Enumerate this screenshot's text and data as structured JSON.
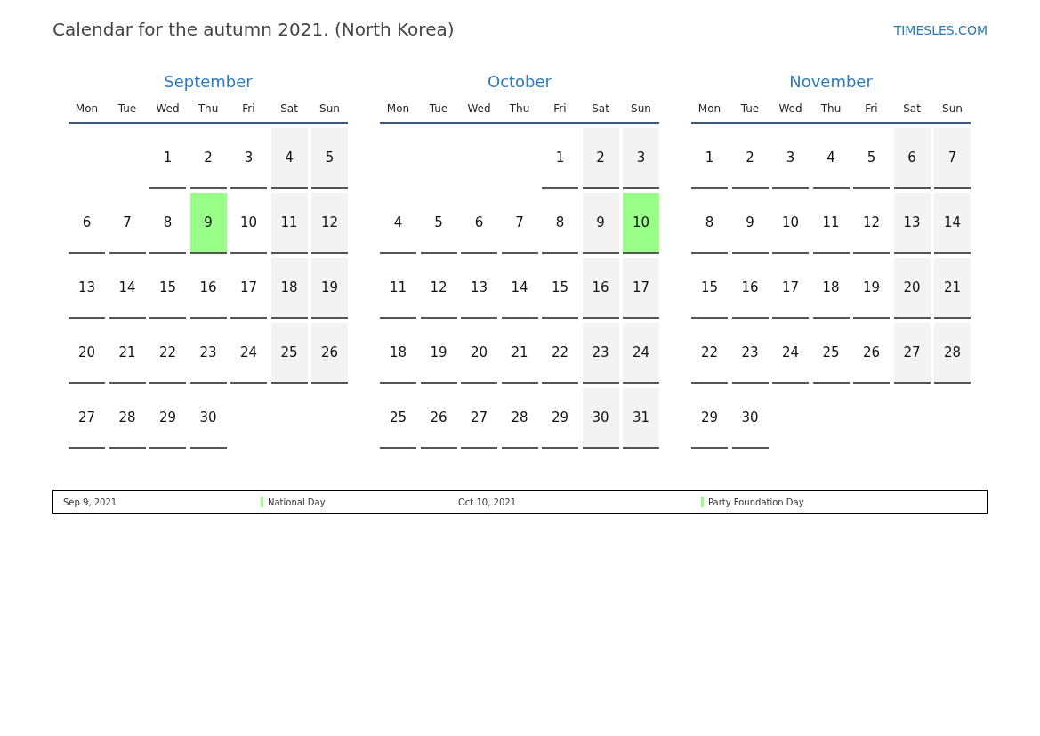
{
  "title": "Calendar for the autumn 2021. (North Korea)",
  "site_link": "TIMESLES.COM",
  "months": [
    {
      "name": "September",
      "weekdays": [
        "Mon",
        "Tue",
        "Wed",
        "Thu",
        "Fri",
        "Sat",
        "Sun"
      ],
      "weeks": [
        [
          {
            "d": "1",
            "kind": "weekday"
          },
          {
            "d": "2",
            "kind": "weekday"
          },
          {
            "d": "3",
            "kind": "weekday"
          },
          {
            "d": "4",
            "kind": "weekend"
          },
          {
            "d": "5",
            "kind": "weekend"
          }
        ],
        [
          {
            "d": "6",
            "kind": "weekday"
          },
          {
            "d": "7",
            "kind": "weekday"
          },
          {
            "d": "8",
            "kind": "weekday"
          },
          {
            "d": "9",
            "kind": "holiday"
          },
          {
            "d": "10",
            "kind": "weekday"
          },
          {
            "d": "11",
            "kind": "weekend"
          },
          {
            "d": "12",
            "kind": "weekend"
          }
        ],
        [
          {
            "d": "13",
            "kind": "weekday"
          },
          {
            "d": "14",
            "kind": "weekday"
          },
          {
            "d": "15",
            "kind": "weekday"
          },
          {
            "d": "16",
            "kind": "weekday"
          },
          {
            "d": "17",
            "kind": "weekday"
          },
          {
            "d": "18",
            "kind": "weekend"
          },
          {
            "d": "19",
            "kind": "weekend"
          }
        ],
        [
          {
            "d": "20",
            "kind": "weekday"
          },
          {
            "d": "21",
            "kind": "weekday"
          },
          {
            "d": "22",
            "kind": "weekday"
          },
          {
            "d": "23",
            "kind": "weekday"
          },
          {
            "d": "24",
            "kind": "weekday"
          },
          {
            "d": "25",
            "kind": "weekend"
          },
          {
            "d": "26",
            "kind": "weekend"
          }
        ],
        [
          {
            "d": "27",
            "kind": "weekday"
          },
          {
            "d": "28",
            "kind": "weekday"
          },
          {
            "d": "29",
            "kind": "weekday"
          },
          {
            "d": "30",
            "kind": "weekday"
          }
        ]
      ]
    },
    {
      "name": "October",
      "weekdays": [
        "Mon",
        "Tue",
        "Wed",
        "Thu",
        "Fri",
        "Sat",
        "Sun"
      ],
      "weeks": [
        [
          {
            "d": "1",
            "kind": "weekday"
          },
          {
            "d": "2",
            "kind": "weekend"
          },
          {
            "d": "3",
            "kind": "weekend"
          }
        ],
        [
          {
            "d": "4",
            "kind": "weekday"
          },
          {
            "d": "5",
            "kind": "weekday"
          },
          {
            "d": "6",
            "kind": "weekday"
          },
          {
            "d": "7",
            "kind": "weekday"
          },
          {
            "d": "8",
            "kind": "weekday"
          },
          {
            "d": "9",
            "kind": "weekend"
          },
          {
            "d": "10",
            "kind": "holiday"
          }
        ],
        [
          {
            "d": "11",
            "kind": "weekday"
          },
          {
            "d": "12",
            "kind": "weekday"
          },
          {
            "d": "13",
            "kind": "weekday"
          },
          {
            "d": "14",
            "kind": "weekday"
          },
          {
            "d": "15",
            "kind": "weekday"
          },
          {
            "d": "16",
            "kind": "weekend"
          },
          {
            "d": "17",
            "kind": "weekend"
          }
        ],
        [
          {
            "d": "18",
            "kind": "weekday"
          },
          {
            "d": "19",
            "kind": "weekday"
          },
          {
            "d": "20",
            "kind": "weekday"
          },
          {
            "d": "21",
            "kind": "weekday"
          },
          {
            "d": "22",
            "kind": "weekday"
          },
          {
            "d": "23",
            "kind": "weekend"
          },
          {
            "d": "24",
            "kind": "weekend"
          }
        ],
        [
          {
            "d": "25",
            "kind": "weekday"
          },
          {
            "d": "26",
            "kind": "weekday"
          },
          {
            "d": "27",
            "kind": "weekday"
          },
          {
            "d": "28",
            "kind": "weekday"
          },
          {
            "d": "29",
            "kind": "weekday"
          },
          {
            "d": "30",
            "kind": "weekend"
          },
          {
            "d": "31",
            "kind": "weekend"
          }
        ]
      ]
    },
    {
      "name": "November",
      "weekdays": [
        "Mon",
        "Tue",
        "Wed",
        "Thu",
        "Fri",
        "Sat",
        "Sun"
      ],
      "weeks": [
        [
          {
            "d": "1",
            "kind": "weekday"
          },
          {
            "d": "2",
            "kind": "weekday"
          },
          {
            "d": "3",
            "kind": "weekday"
          },
          {
            "d": "4",
            "kind": "weekday"
          },
          {
            "d": "5",
            "kind": "weekday"
          },
          {
            "d": "6",
            "kind": "weekend"
          },
          {
            "d": "7",
            "kind": "weekend"
          }
        ],
        [
          {
            "d": "8",
            "kind": "weekday"
          },
          {
            "d": "9",
            "kind": "weekday"
          },
          {
            "d": "10",
            "kind": "weekday"
          },
          {
            "d": "11",
            "kind": "weekday"
          },
          {
            "d": "12",
            "kind": "weekday"
          },
          {
            "d": "13",
            "kind": "weekend"
          },
          {
            "d": "14",
            "kind": "weekend"
          }
        ],
        [
          {
            "d": "15",
            "kind": "weekday"
          },
          {
            "d": "16",
            "kind": "weekday"
          },
          {
            "d": "17",
            "kind": "weekday"
          },
          {
            "d": "18",
            "kind": "weekday"
          },
          {
            "d": "19",
            "kind": "weekday"
          },
          {
            "d": "20",
            "kind": "weekend"
          },
          {
            "d": "21",
            "kind": "weekend"
          }
        ],
        [
          {
            "d": "22",
            "kind": "weekday"
          },
          {
            "d": "23",
            "kind": "weekday"
          },
          {
            "d": "24",
            "kind": "weekday"
          },
          {
            "d": "25",
            "kind": "weekday"
          },
          {
            "d": "26",
            "kind": "weekday"
          },
          {
            "d": "27",
            "kind": "weekend"
          },
          {
            "d": "28",
            "kind": "weekend"
          }
        ],
        [
          {
            "d": "29",
            "kind": "weekday"
          },
          {
            "d": "30",
            "kind": "weekday"
          }
        ]
      ]
    }
  ],
  "holidays": [
    {
      "date": "Sep 9, 2021",
      "name": "National Day",
      "color": "#99ff88"
    },
    {
      "date": "Oct 10, 2021",
      "name": "Party Foundation Day",
      "color": "#99ff88"
    }
  ]
}
